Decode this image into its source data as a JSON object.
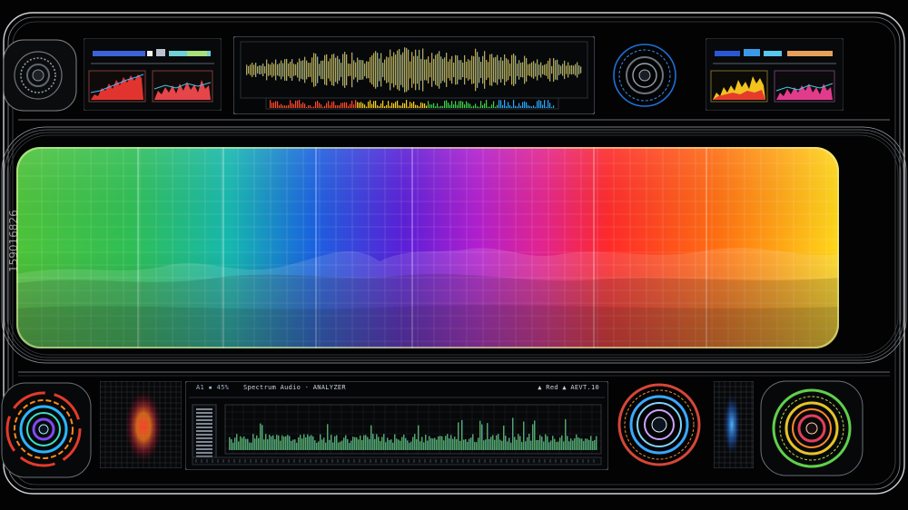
{
  "colors": {
    "background": "#030303",
    "frame": "#c9ccd2",
    "spectrum": [
      "#3fbf3c",
      "#17b8a8",
      "#1b5fe0",
      "#7b22d6",
      "#d025b0",
      "#ff2a2a",
      "#ff7a12",
      "#ffd21a"
    ]
  },
  "icons": {
    "left_top_dial": "dial-icon",
    "right_top_dial": "dial-icon",
    "bottom_dials": "concentric-ring-icon"
  },
  "bottom_panel": {
    "status_left": "A1 ▪ 45%",
    "title": "Spectrum Audio · ANALYZER",
    "readout_right": "▲ Red ▲ AEVT.10"
  },
  "watermark": "159016826"
}
